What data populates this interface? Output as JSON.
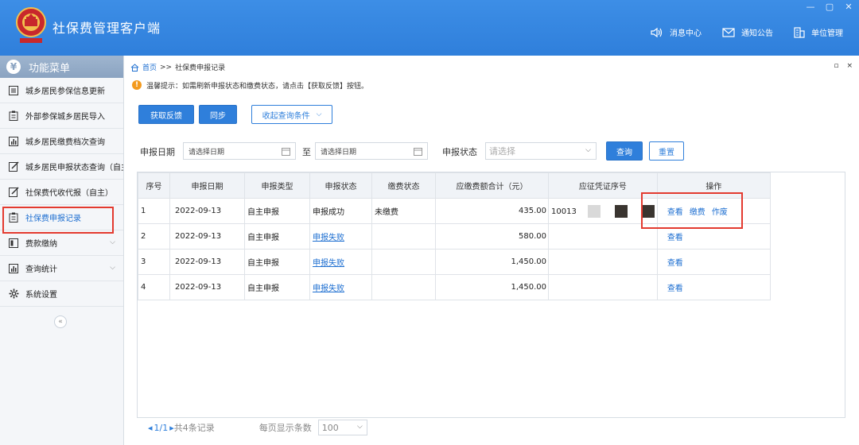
{
  "app": {
    "title": "社保费管理客户端",
    "nav": [
      {
        "label": "消息中心",
        "icon": "speaker-icon"
      },
      {
        "label": "通知公告",
        "icon": "mail-icon"
      },
      {
        "label": "单位管理",
        "icon": "building-icon"
      }
    ],
    "window_controls": [
      "—",
      "▢",
      "✕"
    ]
  },
  "sidebar": {
    "title": "功能菜单",
    "items": [
      {
        "label": "城乡居民参保信息更新",
        "icon": "list-icon",
        "active": false
      },
      {
        "label": "外部参保城乡居民导入",
        "icon": "clipboard-icon",
        "active": false
      },
      {
        "label": "城乡居民缴费档次查询",
        "icon": "bar-chart-icon",
        "active": false
      },
      {
        "label": "城乡居民申报状态查询（自主",
        "icon": "edit-icon",
        "active": false
      },
      {
        "label": "社保费代收代报（自主）",
        "icon": "edit-icon",
        "active": false
      },
      {
        "label": "社保费申报记录",
        "icon": "clipboard-icon",
        "active": true
      },
      {
        "label": "费款缴纳",
        "icon": "book-icon",
        "active": false,
        "expand": true
      },
      {
        "label": "查询统计",
        "icon": "bar-chart-icon",
        "active": false,
        "expand": true
      },
      {
        "label": "系统设置",
        "icon": "gear-icon",
        "active": false
      }
    ],
    "collapse": "«"
  },
  "breadcrumb": {
    "home": "首页",
    "sep": ">>",
    "current": "社保费申报记录"
  },
  "panel_controls": [
    "▫",
    "×"
  ],
  "notice": "温馨提示：如需刷新申报状态和缴费状态，请点击【获取反馈】按钮。",
  "toolbar": {
    "fetch": "获取反馈",
    "sync": "同步",
    "collapse_filter": "收起查询条件"
  },
  "filters": {
    "date_label": "申报日期",
    "date_start_placeholder": "请选择日期",
    "to": "至",
    "date_end_placeholder": "请选择日期",
    "status_label": "申报状态",
    "status_placeholder": "请选择",
    "query": "查询",
    "reset": "重置"
  },
  "table": {
    "columns": [
      "序号",
      "申报日期",
      "申报类型",
      "申报状态",
      "缴费状态",
      "应缴费额合计（元）",
      "应征凭证序号",
      "操作"
    ],
    "rows": [
      {
        "no": "1",
        "date": "2022-09-13",
        "type": "自主申报",
        "status": "申报成功",
        "pay": "未缴费",
        "amount": "435.00",
        "voucher": "10013",
        "ops": [
          "查看",
          "缴费",
          "作废"
        ]
      },
      {
        "no": "2",
        "date": "2022-09-13",
        "type": "自主申报",
        "status": "申报失败",
        "pay": "",
        "amount": "580.00",
        "voucher": "",
        "ops": [
          "查看"
        ]
      },
      {
        "no": "3",
        "date": "2022-09-13",
        "type": "自主申报",
        "status": "申报失败",
        "pay": "",
        "amount": "1,450.00",
        "voucher": "",
        "ops": [
          "查看"
        ]
      },
      {
        "no": "4",
        "date": "2022-09-13",
        "type": "自主申报",
        "status": "申报失败",
        "pay": "",
        "amount": "1,450.00",
        "voucher": "",
        "ops": [
          "查看"
        ]
      }
    ]
  },
  "pager": {
    "page": "1/1",
    "total": "共4条记录",
    "page_size_label": "每页显示条数",
    "page_size": "100"
  },
  "colors": {
    "brand": "#2f7fdb",
    "highlight": "#e33a2f",
    "warn": "#f39a1e"
  }
}
